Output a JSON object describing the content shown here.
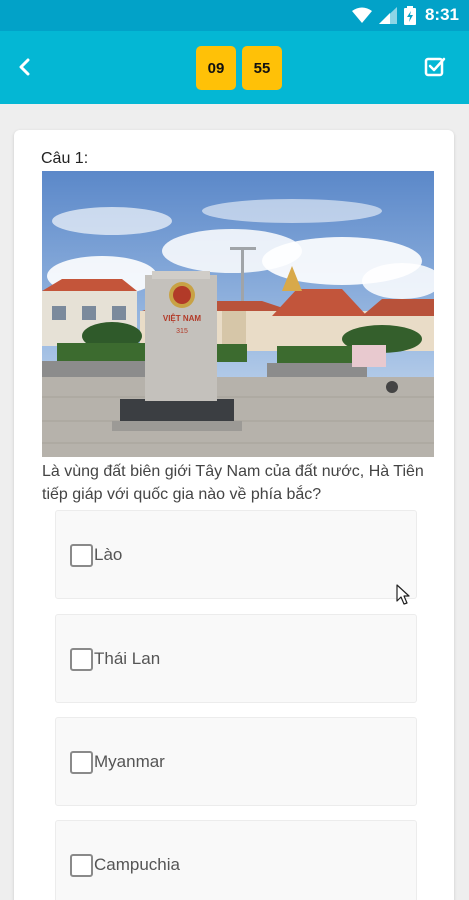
{
  "status_bar": {
    "time": "8:31",
    "icons": [
      "wifi-icon",
      "signal-icon",
      "battery-icon"
    ]
  },
  "app_bar": {
    "back_icon": "chevron-left-icon",
    "timer": {
      "minutes": "09",
      "seconds": "55"
    },
    "submit_icon": "checkbox-checked-icon"
  },
  "question": {
    "number_label": "Câu 1:",
    "image_icon": "border-marker-photo",
    "image_marker_text": "VIỆT NAM",
    "image_marker_number": "315",
    "text": "Là vùng đất biên giới Tây Nam của đất nước, Hà Tiên tiếp giáp với quốc gia nào về phía bắc?"
  },
  "answers": [
    {
      "label": "Lào",
      "checked": false
    },
    {
      "label": "Thái Lan",
      "checked": false
    },
    {
      "label": "Myanmar",
      "checked": false
    },
    {
      "label": "Campuchia",
      "checked": false
    }
  ],
  "colors": {
    "status_bar": "#02a2c8",
    "app_bar": "#04b7d4",
    "timer": "#ffc107",
    "card": "#ffffff",
    "background": "#eeeeee"
  }
}
